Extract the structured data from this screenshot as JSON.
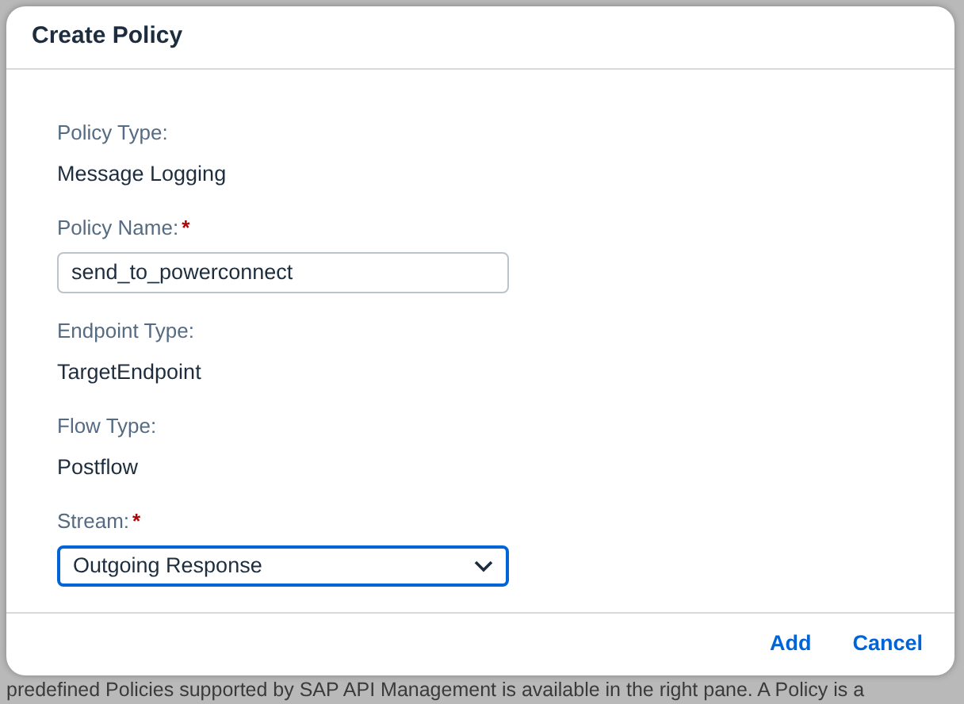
{
  "dialog": {
    "title": "Create Policy",
    "fields": [
      {
        "kind": "display",
        "label": "Policy Type:",
        "required": false,
        "value": "Message Logging"
      },
      {
        "kind": "input",
        "label": "Policy Name:",
        "required": true,
        "value": "send_to_powerconnect",
        "focused": false
      },
      {
        "kind": "display",
        "label": "Endpoint Type:",
        "required": false,
        "value": "TargetEndpoint"
      },
      {
        "kind": "display",
        "label": "Flow Type:",
        "required": false,
        "value": "Postflow"
      },
      {
        "kind": "select",
        "label": "Stream:",
        "required": true,
        "value": "Outgoing Response",
        "focused": true
      }
    ],
    "required_mark": "*",
    "buttons": [
      "Add",
      "Cancel"
    ]
  },
  "background_text": "predefined Policies supported by SAP API Management is available in the right pane. A Policy is a"
}
